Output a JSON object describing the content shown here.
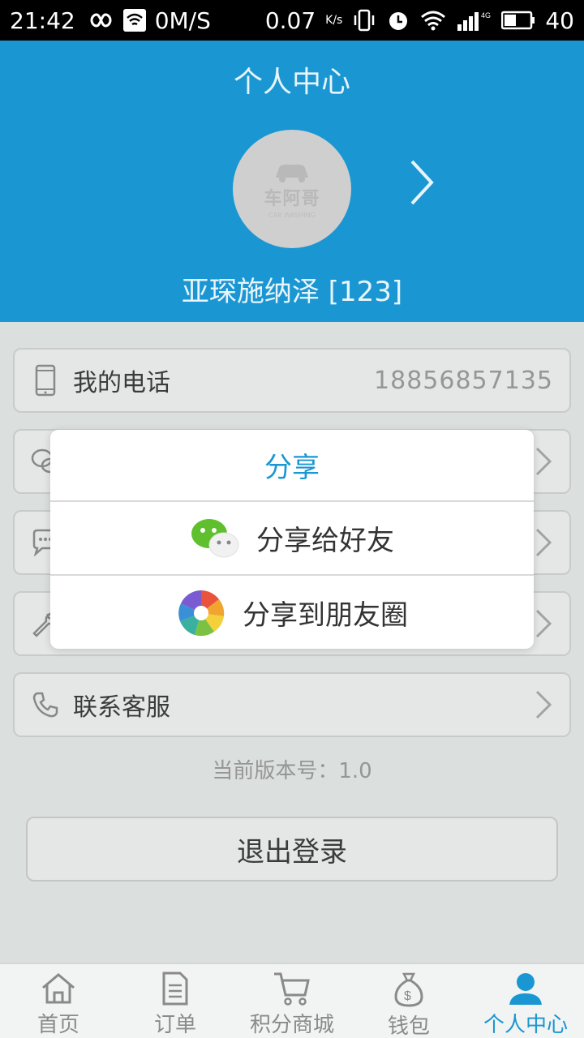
{
  "status_bar": {
    "time": "21:42",
    "net_speed": "0M/S",
    "data_rate": "0.07",
    "data_unit": "K/s",
    "battery": "40"
  },
  "header": {
    "title": "个人中心",
    "avatar_logo": "车阿哥",
    "avatar_logo_sub": "CAR WASHING",
    "user_name": "亚琛施纳泽 [123]"
  },
  "rows": {
    "phone_label": "我的电话",
    "phone_value": "18856857135",
    "contact_label": "联系客服"
  },
  "version": "当前版本号：1.0",
  "logout_label": "退出登录",
  "share_dialog": {
    "title": "分享",
    "friend_label": "分享给好友",
    "moments_label": "分享到朋友圈"
  },
  "nav": {
    "home": "首页",
    "orders": "订单",
    "points_mall": "积分商城",
    "wallet": "钱包",
    "profile": "个人中心"
  },
  "colors": {
    "accent": "#1a97d2",
    "wechat_green": "#5fbf2c"
  }
}
